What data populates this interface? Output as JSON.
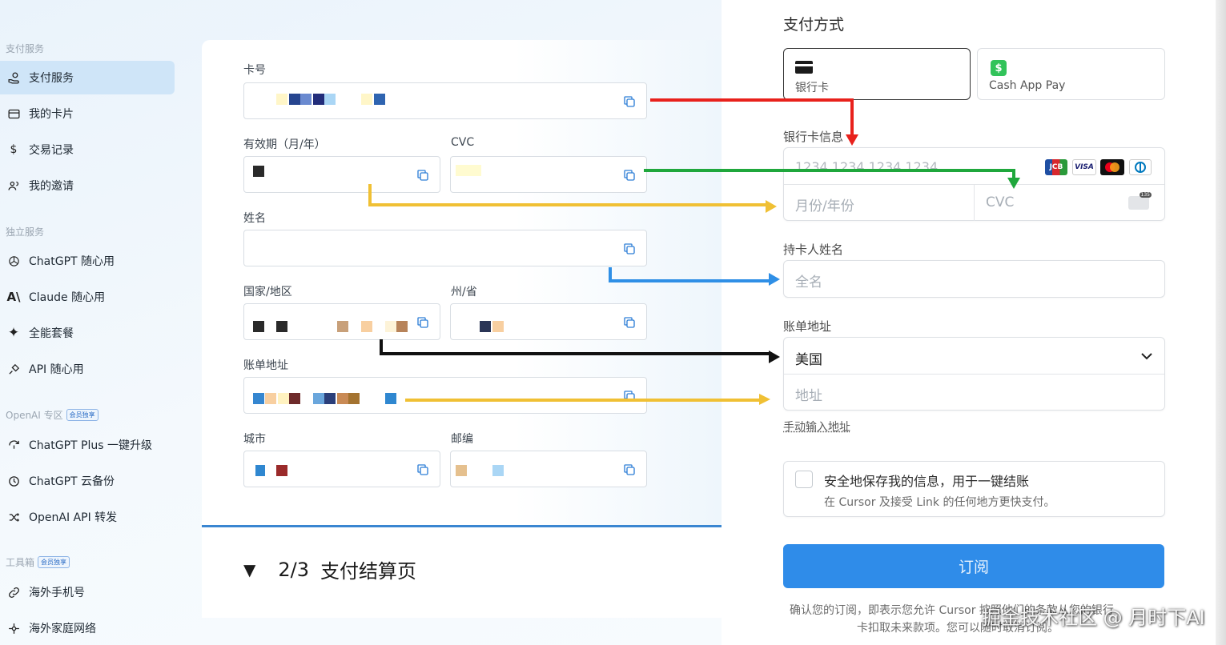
{
  "sidebar": {
    "sections": [
      {
        "title": "支付服务"
      },
      {
        "title": "独立服务"
      },
      {
        "title": "OpenAI 专区",
        "badge": "会员独享"
      },
      {
        "title": "工具箱",
        "badge": "会员独享"
      }
    ],
    "items": [
      {
        "label": "支付服务",
        "icon": "hand-coin-icon",
        "active": true
      },
      {
        "label": "我的卡片",
        "icon": "card-icon"
      },
      {
        "label": "交易记录",
        "icon": "dollar-icon"
      },
      {
        "label": "我的邀请",
        "icon": "users-icon"
      },
      {
        "label": "ChatGPT 随心用",
        "icon": "openai-icon"
      },
      {
        "label": "Claude 随心用",
        "icon": "anthropic-icon"
      },
      {
        "label": "全能套餐",
        "icon": "sparkle-icon"
      },
      {
        "label": "API 随心用",
        "icon": "plug-icon"
      },
      {
        "label": "ChatGPT Plus 一键升级",
        "icon": "refresh-icon"
      },
      {
        "label": "ChatGPT 云备份",
        "icon": "clock-icon"
      },
      {
        "label": "OpenAI API 转发",
        "icon": "shuffle-icon"
      },
      {
        "label": "海外手机号",
        "icon": "link-icon"
      },
      {
        "label": "海外家庭网络",
        "icon": "network-icon"
      }
    ]
  },
  "card_form": {
    "card_number_label": "卡号",
    "expiry_label": "有效期（月/年）",
    "cvc_label": "CVC",
    "name_label": "姓名",
    "country_label": "国家/地区",
    "state_label": "州/省",
    "address_label": "账单地址",
    "city_label": "城市",
    "zip_label": "邮编"
  },
  "step": {
    "number": "2/3",
    "title": "支付结算页"
  },
  "checkout": {
    "title": "支付方式",
    "methods": [
      {
        "label": "银行卡",
        "selected": true
      },
      {
        "label": "Cash App Pay",
        "selected": false
      }
    ],
    "card_info_label": "银行卡信息",
    "card_number_placeholder": "1234 1234 1234 1234",
    "expiry_placeholder": "月份/年份",
    "cvc_placeholder": "CVC",
    "cvc_icon_text": "135",
    "brands": [
      "JCB",
      "VISA",
      "mastercard",
      "diners"
    ],
    "holder_label": "持卡人姓名",
    "holder_placeholder": "全名",
    "billing_label": "账单地址",
    "country_value": "美国",
    "address_placeholder": "地址",
    "manual_link": "手动输入地址",
    "save_title": "安全地保存我的信息，用于一键结账",
    "save_sub": "在 Cursor 及接受 Link 的任何地方更快支付。",
    "subscribe_label": "订阅",
    "footer_line1": "确认您的订阅，即表示您允许 Cursor 按照他们的条款从您的银行",
    "footer_line2": "卡扣取未来款项。您可以随时取消订阅。"
  },
  "watermark": "掘金技术社区 @ 月时下AI",
  "colors": {
    "accent": "#2f8ce9",
    "active_nav": "#cfe5f8",
    "arrow_red": "#e8211c",
    "arrow_green": "#1fa73c",
    "arrow_yellow": "#f0c034",
    "arrow_blue": "#2f8fe6",
    "arrow_black": "#111111"
  }
}
